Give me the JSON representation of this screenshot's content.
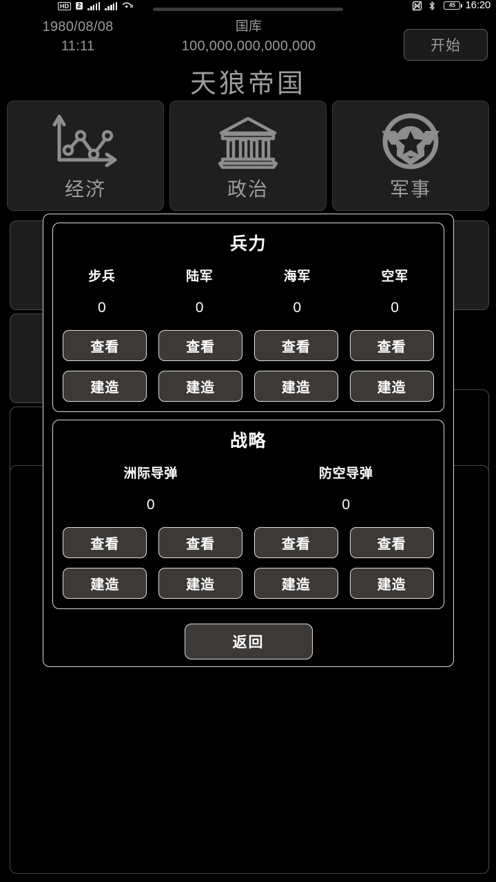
{
  "status_bar": {
    "hd_badge": "HD",
    "sim_badge": "2",
    "time": "16:20",
    "battery_level": "45",
    "icons": [
      "hd-badge-icon",
      "sim2-badge-icon",
      "signal-bars-icon",
      "signal-bars-icon",
      "wifi-icon",
      "nfc-off-icon",
      "bluetooth-icon",
      "battery-icon"
    ]
  },
  "header": {
    "date": "1980/08/08",
    "time": "11:11",
    "treasury_label": "国库",
    "treasury_value": "100,000,000,000,000",
    "start_button": "开始"
  },
  "empire": {
    "title": "天狼帝国"
  },
  "categories": [
    {
      "label": "经济",
      "icon": "line-chart-icon"
    },
    {
      "label": "政治",
      "icon": "bank-building-icon"
    },
    {
      "label": "军事",
      "icon": "military-badge-icon"
    }
  ],
  "background": {
    "year_fragment": "1980"
  },
  "modal": {
    "sections": [
      {
        "title": "兵力",
        "units": [
          {
            "name": "步兵",
            "value": "0"
          },
          {
            "name": "陆军",
            "value": "0"
          },
          {
            "name": "海军",
            "value": "0"
          },
          {
            "name": "空军",
            "value": "0"
          }
        ],
        "view_buttons": [
          "查看",
          "查看",
          "查看",
          "查看"
        ],
        "build_buttons": [
          "建造",
          "建造",
          "建造",
          "建造"
        ]
      },
      {
        "title": "战略",
        "units": [
          {
            "name": "洲际导弹",
            "value": "0"
          },
          {
            "name": "防空导弹",
            "value": "0"
          }
        ],
        "view_buttons": [
          "查看",
          "查看",
          "查看",
          "查看"
        ],
        "build_buttons": [
          "建造",
          "建造",
          "建造",
          "建造"
        ]
      }
    ],
    "back_button": "返回"
  },
  "colors": {
    "background": "#000000",
    "panel_fill": "#1f1f1f",
    "panel_border": "#3b3b3b",
    "modal_border": "#dcdcdc",
    "button_fill": "#3c3937",
    "button_border": "#e2e2e2",
    "dim_text": "#9a9a9a",
    "bright_text": "#ffffff"
  }
}
